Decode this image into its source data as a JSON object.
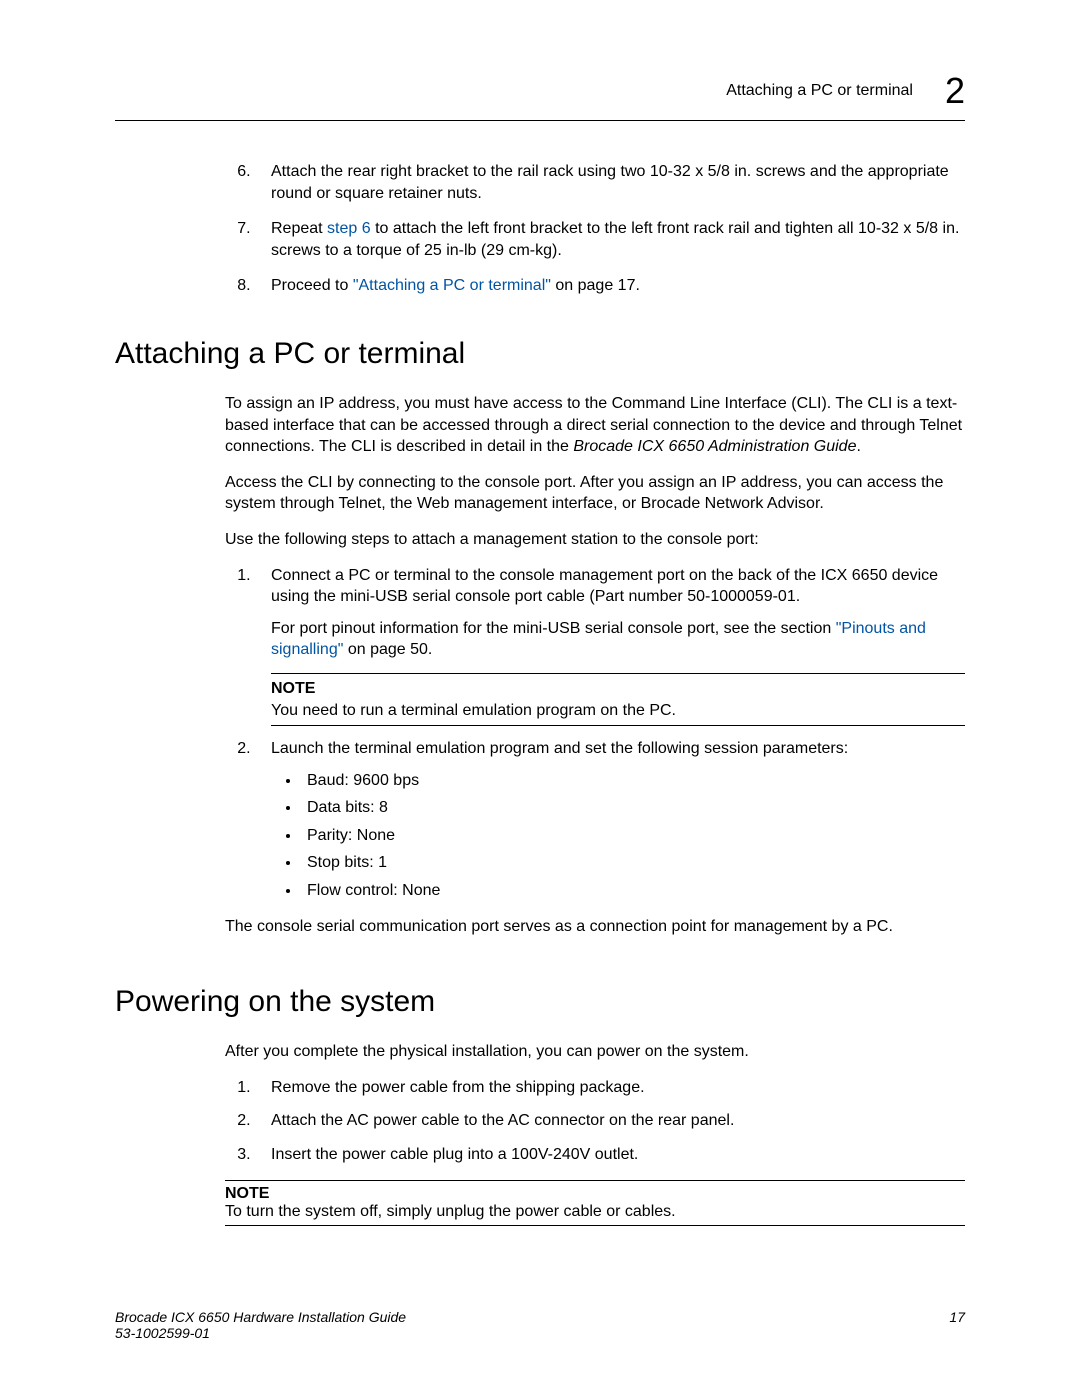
{
  "header": {
    "title": "Attaching a PC or terminal",
    "chapter": "2"
  },
  "topSteps": {
    "start": 6,
    "items": [
      {
        "text": "Attach the rear right bracket to the rail rack using two 10-32 x 5/8 in. screws and the appropriate round or square retainer nuts."
      },
      {
        "pre": "Repeat ",
        "link": "step 6",
        "post": " to attach the left front bracket to the left front rack rail and tighten all 10-32 x 5/8 in. screws to a torque of 25 in-lb (29 cm-kg)."
      },
      {
        "pre": "Proceed to ",
        "link": "\"Attaching a PC or terminal\"",
        "post": " on page 17."
      }
    ]
  },
  "section1": {
    "heading": "Attaching a PC or terminal",
    "p1a": "To assign an IP address, you must have access to the Command Line Interface (CLI). The CLI is a text-based interface that can be accessed through a direct serial connection to the device and through Telnet connections. The CLI is described in detail in the ",
    "p1i": "Brocade ICX 6650 Administration Guide",
    "p1b": ".",
    "p2": "Access the CLI by connecting to the console port. After you assign an IP address, you can access the system through Telnet, the Web management interface, or Brocade Network Advisor.",
    "p3": "Use the following steps to attach a management station to the console port:",
    "steps": [
      {
        "text": "Connect a PC or terminal to the console management port on the back of the ICX 6650 device using the mini-USB serial console port cable (Part number 50-1000059-01.",
        "linkPre": "For port pinout information for the mini-USB serial console port, see the section ",
        "link": "\"Pinouts and signalling\"",
        "linkPost": " on page 50.",
        "note": {
          "label": "NOTE",
          "text": "You need to run a terminal emulation program on the PC."
        }
      },
      {
        "text": "Launch the terminal emulation program and set the following session parameters:",
        "bullets": [
          "Baud: 9600 bps",
          "Data bits: 8",
          "Parity: None",
          "Stop bits: 1",
          "Flow control: None"
        ]
      }
    ],
    "p4": "The console serial communication port serves as a connection point for management by a PC."
  },
  "section2": {
    "heading": "Powering on the system",
    "p1": "After you complete the physical installation, you can power on the system.",
    "steps": [
      "Remove the power cable from the shipping package.",
      "Attach the AC power cable to the AC connector on the rear panel.",
      "Insert the power cable plug into a 100V-240V outlet."
    ],
    "note": {
      "label": "NOTE",
      "text": "To turn the system off, simply unplug the power cable or cables."
    }
  },
  "footer": {
    "left1": "Brocade ICX 6650 Hardware Installation Guide",
    "left2": "53-1002599-01",
    "page": "17"
  }
}
